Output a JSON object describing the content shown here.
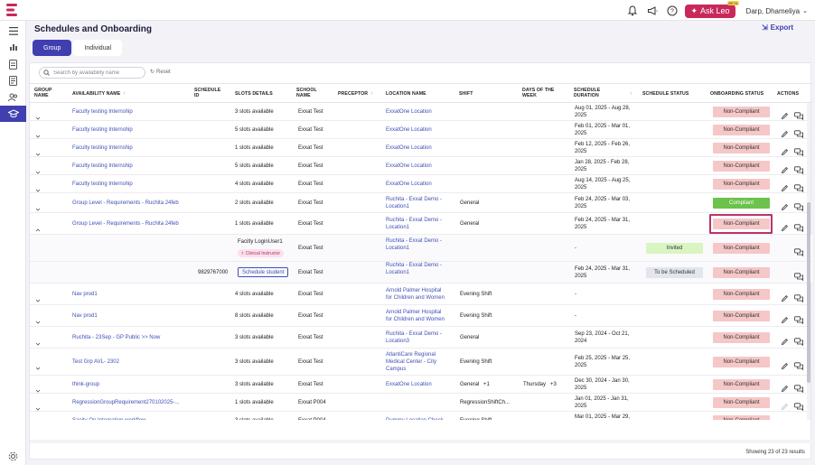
{
  "topbar": {
    "ask_label": "Ask Leo",
    "beta": "BETA",
    "user_name": "Darp, Dhameliya"
  },
  "page": {
    "title": "Schedules and Onboarding",
    "export_label": "Export",
    "tabs": [
      {
        "label": "Group",
        "active": true
      },
      {
        "label": "Individual",
        "active": false
      }
    ],
    "search_placeholder": "Search by availability name",
    "reset_label": "Reset",
    "footer": "Showing 23 of 23 results"
  },
  "columns": {
    "group_name": "GROUP NAME",
    "availability": "AVAILABILITY NAME",
    "schedule_id": "SCHEDULE ID",
    "slots": "SLOTS DETAILS",
    "school": "SCHOOL NAME",
    "preceptor": "PRECEPTOR",
    "location": "LOCATION NAME",
    "shift": "SHIFT",
    "days": "DAYS OF THE WEEK",
    "duration": "SCHEDULE DURATION",
    "status": "SCHEDULE STATUS",
    "onboarding": "ONBOARDING STATUS",
    "actions": "ACTIONS"
  },
  "rows": [
    {
      "name": "Faculty testing Internship",
      "id": "",
      "slots": "3 slots available",
      "school": "Exxat Test",
      "loc1": "ExxatOne Location",
      "loc2": "",
      "shift": "",
      "days": "",
      "dur1": "Aug 01, 2025 - Aug 28,",
      "dur2": "2025",
      "onboarding": "Non-Compliant",
      "kind": "nc"
    },
    {
      "name": "Faculty testing Internship",
      "id": "",
      "slots": "5 slots available",
      "school": "Exxat Test",
      "loc1": "ExxatOne Location",
      "loc2": "",
      "shift": "",
      "days": "",
      "dur1": "Feb 01, 2025 - Mar 01,",
      "dur2": "2025",
      "onboarding": "Non-Compliant",
      "kind": "nc"
    },
    {
      "name": "Faculty testing Internship",
      "id": "",
      "slots": "1 slots available",
      "school": "Exxat Test",
      "loc1": "ExxatOne Location",
      "loc2": "",
      "shift": "",
      "days": "",
      "dur1": "Feb 12, 2025 - Feb 26,",
      "dur2": "2025",
      "onboarding": "Non-Compliant",
      "kind": "nc"
    },
    {
      "name": "Faculty testing Internship",
      "id": "",
      "slots": "5 slots available",
      "school": "Exxat Test",
      "loc1": "ExxatOne Location",
      "loc2": "",
      "shift": "",
      "days": "",
      "dur1": "Jan 28, 2025 - Feb 28,",
      "dur2": "2025",
      "onboarding": "Non-Compliant",
      "kind": "nc"
    },
    {
      "name": "Faculty testing Internship",
      "id": "",
      "slots": "4 slots available",
      "school": "Exxat Test",
      "loc1": "ExxatOne Location",
      "loc2": "",
      "shift": "",
      "days": "",
      "dur1": "Aug 14, 2025 - Aug 25,",
      "dur2": "2025",
      "onboarding": "Non-Compliant",
      "kind": "nc"
    },
    {
      "name": "Group Level - Requirements - Ruchita 24feb",
      "id": "",
      "slots": "2 slots available",
      "school": "Exxat Test",
      "loc1": "Ruchita - Exxat Demo -",
      "loc2": "Location1",
      "shift": "General",
      "days": "",
      "dur1": "Feb 24, 2025 - Mar 03,",
      "dur2": "2025",
      "onboarding": "Compliant",
      "kind": "comp"
    },
    {
      "name": "Group Level - Requirements - Ruchita 24feb",
      "id": "",
      "slots": "1 slots available",
      "school": "Exxat Test",
      "loc1": "Ruchita - Exxat Demo -",
      "loc2": "Location1",
      "shift": "General",
      "days": "",
      "dur1": "Feb 24, 2025 - Mar 31,",
      "dur2": "2025",
      "onboarding": "Non-Compliant",
      "kind": "nc"
    },
    {
      "name": "Nav prod1",
      "id": "",
      "slots": "4 slots available",
      "school": "Exxat Test",
      "loc1": "Arnold Palmer Hospital",
      "loc2": "for Children and Women",
      "shift": "Evening Shift",
      "days": "",
      "dur1": "-",
      "dur2": "",
      "onboarding": "Non-Compliant",
      "kind": "nc"
    },
    {
      "name": "Nav prod1",
      "id": "",
      "slots": "8 slots available",
      "school": "Exxat Test",
      "loc1": "Arnold Palmer Hospital",
      "loc2": "for Children and Women",
      "shift": "Evening Shift",
      "days": "",
      "dur1": "-",
      "dur2": "",
      "onboarding": "Non-Compliant",
      "kind": "nc"
    },
    {
      "name": "Ruchita - 23Sep - GP Public >> Now",
      "id": "",
      "slots": "3 slots available",
      "school": "Exxat Test",
      "loc1": "Ruchita - Exxat Demo -",
      "loc2": "Location3",
      "shift": "General",
      "days": "",
      "dur1": "Sep 23, 2024 - Oct 21,",
      "dur2": "2024",
      "onboarding": "Non-Compliant",
      "kind": "nc"
    },
    {
      "name": "Test Grp AVL- 2302",
      "id": "",
      "slots": "3 slots available",
      "school": "Exxat Test",
      "loc1": "AtlantiCare Regional",
      "loc2": "Medical Center - City",
      "loc3": "Campus",
      "shift": "Evening Shift",
      "days": "",
      "dur1": "Feb 25, 2025 - Mar 25,",
      "dur2": "2025",
      "onboarding": "Non-Compliant",
      "kind": "nc"
    },
    {
      "name": "think-group",
      "id": "",
      "slots": "3 slots available",
      "school": "Exxat Test",
      "loc1": "ExxatOne Location",
      "loc2": "",
      "shift": "General",
      "shift_more": "+1",
      "days": "Thursday",
      "days_more": "+3",
      "dur1": "Dec 30, 2024 - Jan 30,",
      "dur2": "2025",
      "onboarding": "Non-Compliant",
      "kind": "nc"
    },
    {
      "name": "RegressionGroupRequirement270102025-...",
      "id": "",
      "slots": "1 slots available",
      "school": "Exxat P004",
      "loc1": "",
      "loc2": "",
      "shift": "RegressionShiftCh...",
      "days": "",
      "dur1": "Jan 01, 2025 - Jan 31,",
      "dur2": "2025",
      "onboarding": "Non-Compliant",
      "kind": "nc"
    },
    {
      "name": "Sanity On Integration workflow",
      "id": "",
      "slots": "3 slots available",
      "school": "Exxat P004",
      "loc1": "Dummy Location Check",
      "loc2": "",
      "shift": "Evening Shift",
      "days": "",
      "dur1": "Mar 01, 2025 - Mar 29,",
      "dur2": "2025",
      "onboarding": "Non-Compliant",
      "kind": "nc"
    }
  ],
  "subrows": {
    "faculty": {
      "name": "Facilty LoginUser1",
      "tag": "Clinical Instructor",
      "school": "Exxat Test",
      "loc1": "Ruchita - Exxat Demo -",
      "loc2": "Location1",
      "dur1": "-",
      "status": "Invited",
      "onboarding": "Non-Compliant"
    },
    "student": {
      "id": "9829767000",
      "button": "Schedule student",
      "school": "Exxat Test",
      "loc1": "Ruchita - Exxat Demo -",
      "loc2": "Location1",
      "dur1": "Feb 24, 2025 - Mar 31,",
      "dur2": "2025",
      "status": "To be Scheduled",
      "onboarding": "Non-Compliant"
    }
  },
  "colors": {
    "primary": "#3f3fb0",
    "brand": "#c8285a",
    "noncompliant": "#f5c7c7",
    "compliant": "#6cc24a"
  }
}
